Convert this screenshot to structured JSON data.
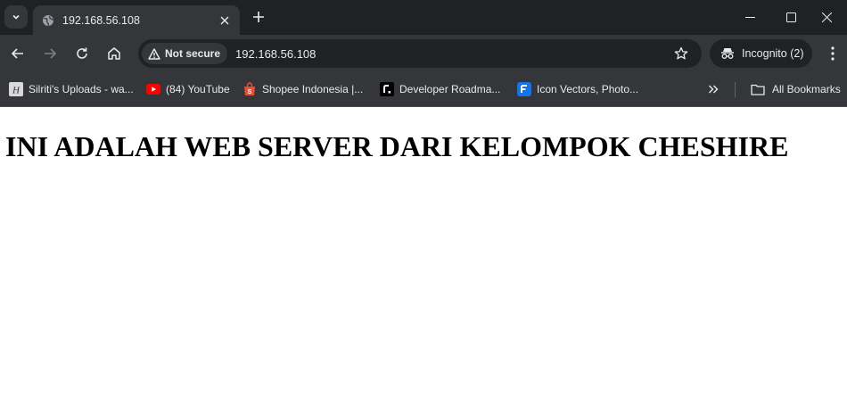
{
  "browser": {
    "tab": {
      "title": "192.168.56.108"
    },
    "address": {
      "security_label": "Not secure",
      "url": "192.168.56.108"
    },
    "incognito": {
      "label": "Incognito (2)"
    },
    "bookmarks": [
      {
        "label": "Silriti's Uploads - wa...",
        "icon": "silriti-icon"
      },
      {
        "label": "(84) YouTube",
        "icon": "youtube-icon"
      },
      {
        "label": "Shopee Indonesia |...",
        "icon": "shopee-icon"
      },
      {
        "label": "Developer Roadma...",
        "icon": "roadmap-icon"
      },
      {
        "label": "Icon Vectors, Photo...",
        "icon": "freepik-icon"
      }
    ],
    "all_bookmarks_label": "All Bookmarks"
  },
  "page": {
    "heading": "INI ADALAH WEB SERVER DARI KELOMPOK CHESHIRE"
  },
  "colors": {
    "chrome_dark": "#202124",
    "chrome_light": "#35363a",
    "text": "#e8eaed",
    "youtube_red": "#ff0000",
    "shopee_orange": "#ee4d2d",
    "freepik_blue": "#1273eb"
  }
}
